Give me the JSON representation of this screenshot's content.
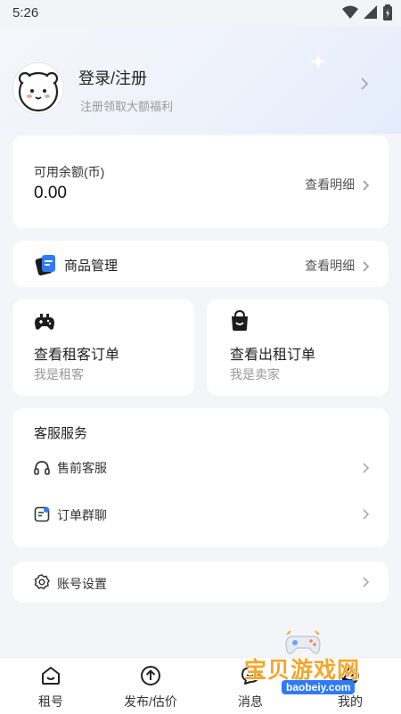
{
  "status": {
    "time": "5:26"
  },
  "profile": {
    "title": "登录/注册",
    "subtitle": "注册领取大额福利"
  },
  "balance": {
    "label": "可用余额(币)",
    "value": "0.00",
    "link": "查看明细"
  },
  "goods": {
    "label": "商品管理",
    "link": "查看明细"
  },
  "orders": {
    "renter": {
      "title": "查看租客订单",
      "subtitle": "我是租客"
    },
    "lessor": {
      "title": "查看出租订单",
      "subtitle": "我是卖家"
    }
  },
  "service": {
    "title": "客服服务",
    "items": [
      {
        "label": "售前客服"
      },
      {
        "label": "订单群聊"
      }
    ]
  },
  "settings": {
    "label": "账号设置"
  },
  "tabbar": {
    "items": [
      {
        "label": "租号"
      },
      {
        "label": "发布/估价"
      },
      {
        "label": "消息"
      },
      {
        "label": "我的"
      }
    ]
  },
  "watermark": {
    "text": "宝贝游戏网",
    "url": "baobeiy.com"
  },
  "colors": {
    "accent": "#2f7bf6",
    "background": "#f4f5f9",
    "card": "#ffffff"
  }
}
